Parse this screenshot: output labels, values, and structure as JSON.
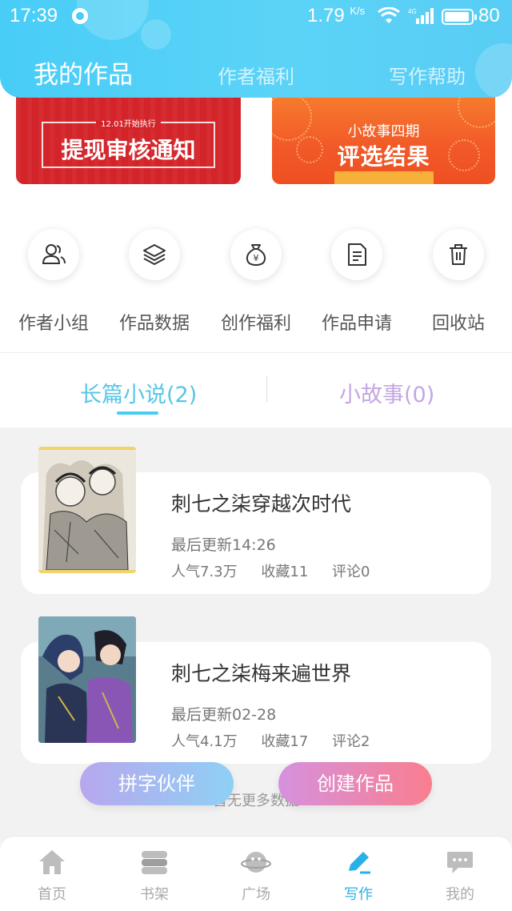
{
  "status_bar": {
    "time": "17:39",
    "speed": "1.79",
    "speed_unit": "K/s",
    "network": "4G",
    "battery": "80"
  },
  "header": {
    "tabs": [
      {
        "label": "我的作品",
        "active": true
      },
      {
        "label": "作者福利",
        "active": false
      },
      {
        "label": "写作帮助",
        "active": false
      }
    ]
  },
  "banners": [
    {
      "subtitle": "12.01开始执行",
      "title": "提现审核通知"
    },
    {
      "line1": "小故事四期",
      "title": "评选结果"
    }
  ],
  "quick_actions": [
    {
      "label": "作者小组",
      "icon": "author-group-icon"
    },
    {
      "label": "作品数据",
      "icon": "layers-icon"
    },
    {
      "label": "创作福利",
      "icon": "money-bag-icon"
    },
    {
      "label": "作品申请",
      "icon": "document-icon"
    },
    {
      "label": "回收站",
      "icon": "trash-icon"
    }
  ],
  "section_tabs": {
    "long": "长篇小说(2)",
    "short": "小故事(0)"
  },
  "works": [
    {
      "title": "刺七之柒穿越次时代",
      "updated": "最后更新14:26",
      "popularity": "人气7.3万",
      "favorites": "收藏11",
      "comments": "评论0"
    },
    {
      "title": "刺七之柒梅来遍世界",
      "updated": "最后更新02-28",
      "popularity": "人气4.1万",
      "favorites": "收藏17",
      "comments": "评论2"
    }
  ],
  "no_more": "暂无更多数据",
  "float_buttons": {
    "partner": "拼字伙伴",
    "create": "创建作品"
  },
  "bottom_nav": [
    {
      "label": "首页",
      "icon": "home-icon",
      "active": false
    },
    {
      "label": "书架",
      "icon": "bookshelf-icon",
      "active": false
    },
    {
      "label": "广场",
      "icon": "planet-icon",
      "active": false
    },
    {
      "label": "写作",
      "icon": "pen-icon",
      "active": true
    },
    {
      "label": "我的",
      "icon": "chat-bubble-icon",
      "active": false
    }
  ],
  "colors": {
    "header": "#48cdf7",
    "accent": "#2ab0e8",
    "short_tab": "#c3a6e3"
  }
}
